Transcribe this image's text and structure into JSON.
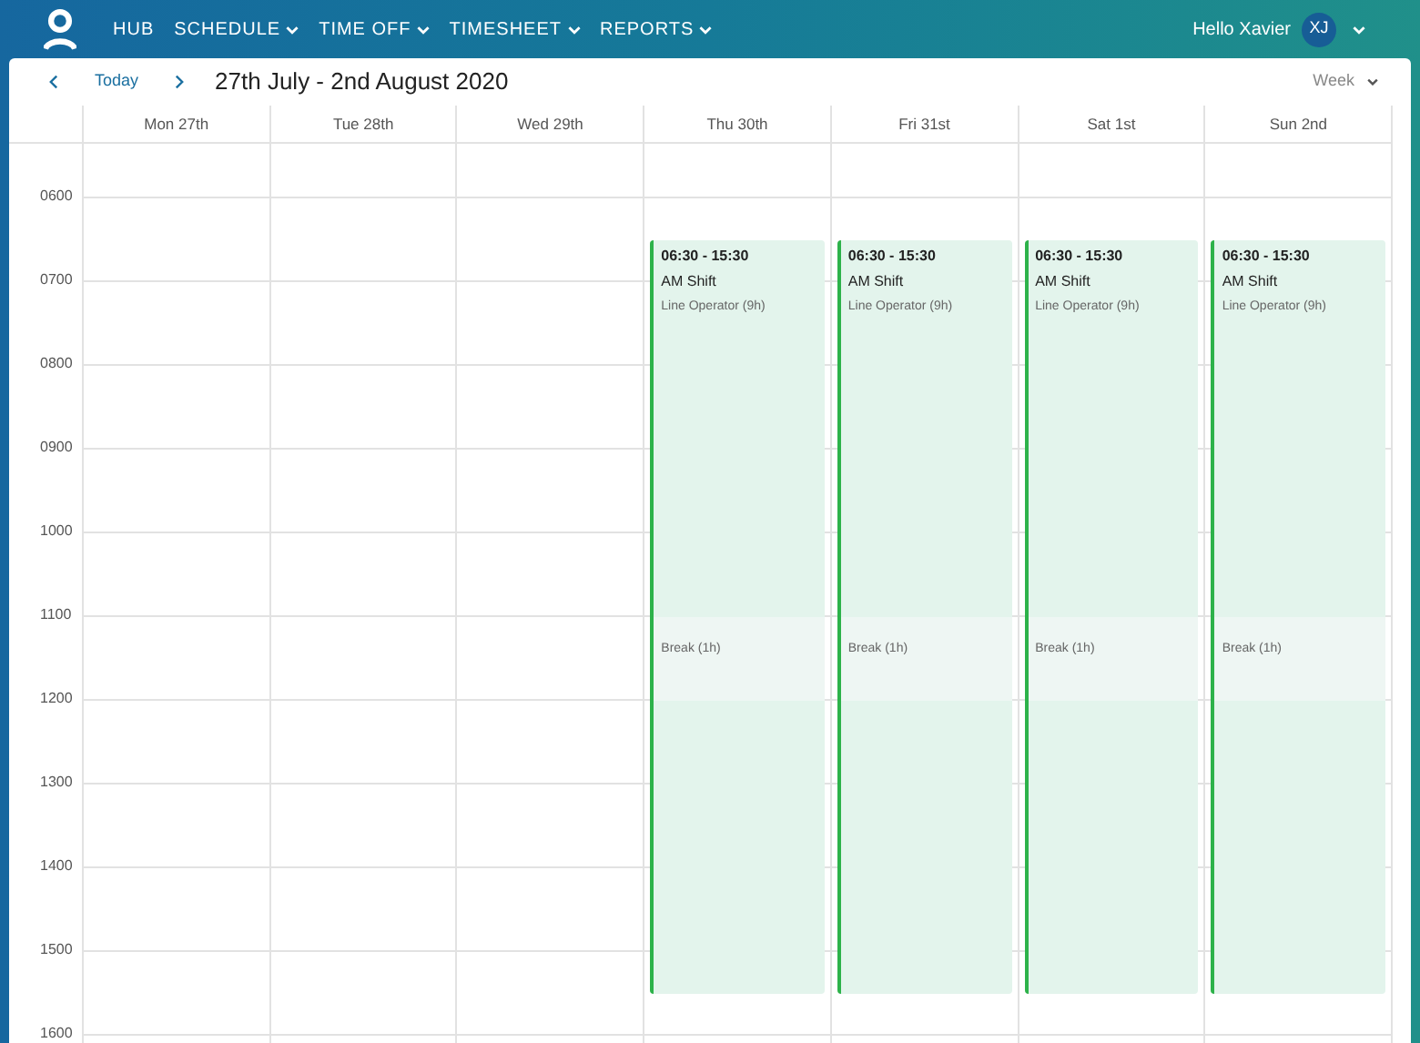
{
  "nav": {
    "items": [
      {
        "label": "HUB",
        "has_menu": false
      },
      {
        "label": "SCHEDULE",
        "has_menu": true
      },
      {
        "label": "TIME OFF",
        "has_menu": true
      },
      {
        "label": "TIMESHEET",
        "has_menu": true
      },
      {
        "label": "REPORTS",
        "has_menu": true
      }
    ],
    "greeting": "Hello Xavier",
    "avatar": "XJ"
  },
  "toolbar": {
    "today": "Today",
    "range": "27th July - 2nd August 2020",
    "view": "Week"
  },
  "hours": [
    "0600",
    "0700",
    "0800",
    "0900",
    "1000",
    "1100",
    "1200",
    "1300",
    "1400",
    "1500",
    "1600"
  ],
  "days": [
    {
      "label": "Mon 27th"
    },
    {
      "label": "Tue 28th"
    },
    {
      "label": "Wed 29th"
    },
    {
      "label": "Thu 30th",
      "shifts": [
        {
          "time": "06:30 - 15:30",
          "title": "AM Shift",
          "role": "Line Operator (9h)",
          "break": "Break (1h)"
        }
      ]
    },
    {
      "label": "Fri 31st",
      "shifts": [
        {
          "time": "06:30 - 15:30",
          "title": "AM Shift",
          "role": "Line Operator (9h)",
          "break": "Break (1h)"
        }
      ]
    },
    {
      "label": "Sat 1st",
      "shifts": [
        {
          "time": "06:30 - 15:30",
          "title": "AM Shift",
          "role": "Line Operator (9h)",
          "break": "Break (1h)"
        }
      ]
    },
    {
      "label": "Sun 2nd",
      "shifts": [
        {
          "time": "06:30 - 15:30",
          "title": "AM Shift",
          "role": "Line Operator (9h)",
          "break": "Break (1h)"
        }
      ]
    }
  ]
}
